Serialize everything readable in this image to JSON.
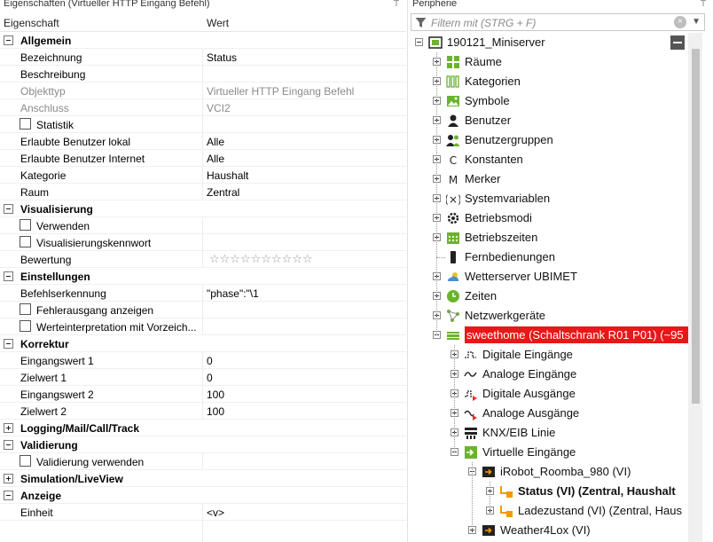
{
  "props": {
    "title": "Eigenschaften (Virtueller HTTP Eingang Befehl)",
    "col_name": "Eigenschaft",
    "col_value": "Wert",
    "rows": [
      {
        "kind": "cat",
        "label": "Allgemein",
        "expanded": true
      },
      {
        "kind": "prop",
        "label": "Bezeichnung",
        "value": "Status"
      },
      {
        "kind": "prop",
        "label": "Beschreibung",
        "value": ""
      },
      {
        "kind": "prop",
        "label": "Objekttyp",
        "value": "Virtueller HTTP Eingang Befehl",
        "disabled": true
      },
      {
        "kind": "prop",
        "label": "Anschluss",
        "value": "VCI2",
        "disabled": true
      },
      {
        "kind": "check",
        "label": "Statistik",
        "checked": false
      },
      {
        "kind": "prop",
        "label": "Erlaubte Benutzer lokal",
        "value": "Alle"
      },
      {
        "kind": "prop",
        "label": "Erlaubte Benutzer Internet",
        "value": "Alle"
      },
      {
        "kind": "prop",
        "label": "Kategorie",
        "value": "Haushalt"
      },
      {
        "kind": "prop",
        "label": "Raum",
        "value": "Zentral"
      },
      {
        "kind": "cat",
        "label": "Visualisierung",
        "expanded": true
      },
      {
        "kind": "check",
        "label": "Verwenden",
        "checked": false
      },
      {
        "kind": "check",
        "label": "Visualisierungskennwort",
        "checked": false
      },
      {
        "kind": "stars",
        "label": "Bewertung",
        "value": "☆☆☆☆☆☆☆☆☆☆"
      },
      {
        "kind": "cat",
        "label": "Einstellungen",
        "expanded": true
      },
      {
        "kind": "prop",
        "label": "Befehlserkennung",
        "value": "\"phase\":\"\\1"
      },
      {
        "kind": "check",
        "label": "Fehlerausgang anzeigen",
        "checked": false
      },
      {
        "kind": "check",
        "label": "Werteinterpretation mit Vorzeich...",
        "checked": false
      },
      {
        "kind": "cat",
        "label": "Korrektur",
        "expanded": true
      },
      {
        "kind": "prop",
        "label": "Eingangswert 1",
        "value": "0"
      },
      {
        "kind": "prop",
        "label": "Zielwert 1",
        "value": "0"
      },
      {
        "kind": "prop",
        "label": "Eingangswert 2",
        "value": "100"
      },
      {
        "kind": "prop",
        "label": "Zielwert 2",
        "value": "100"
      },
      {
        "kind": "cat",
        "label": "Logging/Mail/Call/Track",
        "expanded": false
      },
      {
        "kind": "cat",
        "label": "Validierung",
        "expanded": true
      },
      {
        "kind": "check",
        "label": "Validierung verwenden",
        "checked": false
      },
      {
        "kind": "cat",
        "label": "Simulation/LiveView",
        "expanded": false
      },
      {
        "kind": "cat",
        "label": "Anzeige",
        "expanded": true
      },
      {
        "kind": "prop",
        "label": "Einheit",
        "value": "<v>"
      }
    ]
  },
  "peri": {
    "title": "Peripherie",
    "filter_placeholder": "Filtern mit (STRG + F)",
    "clear_icon": "×",
    "dropdown_icon": "▼",
    "pin_icon": "📌",
    "tree": [
      {
        "level": 0,
        "label": "190121_Miniserver",
        "icon": "miniserver-icon",
        "exp": "minus"
      },
      {
        "level": 1,
        "label": "Räume",
        "icon": "rooms-icon",
        "exp": "plus"
      },
      {
        "level": 1,
        "label": "Kategorien",
        "icon": "categories-icon",
        "exp": "plus"
      },
      {
        "level": 1,
        "label": "Symbole",
        "icon": "symbols-icon",
        "exp": "plus"
      },
      {
        "level": 1,
        "label": "Benutzer",
        "icon": "user-icon",
        "exp": "plus"
      },
      {
        "level": 1,
        "label": "Benutzergruppen",
        "icon": "usergroups-icon",
        "exp": "plus"
      },
      {
        "level": 1,
        "label": "Konstanten",
        "icon": "constants-icon",
        "exp": "plus",
        "glyph": "C"
      },
      {
        "level": 1,
        "label": "Merker",
        "icon": "flags-icon",
        "exp": "plus",
        "glyph": "M"
      },
      {
        "level": 1,
        "label": "Systemvariablen",
        "icon": "system-variables-icon",
        "exp": "plus",
        "glyph": "(×)"
      },
      {
        "level": 1,
        "label": "Betriebsmodi",
        "icon": "operating-modes-icon",
        "exp": "plus"
      },
      {
        "level": 1,
        "label": "Betriebszeiten",
        "icon": "operating-times-icon",
        "exp": "plus"
      },
      {
        "level": 1,
        "label": "Fernbedienungen",
        "icon": "remote-icon",
        "exp": "none"
      },
      {
        "level": 1,
        "label": "Wetterserver UBIMET",
        "icon": "weather-icon",
        "exp": "plus"
      },
      {
        "level": 1,
        "label": "Zeiten",
        "icon": "clock-icon",
        "exp": "plus"
      },
      {
        "level": 1,
        "label": "Netzwerkgeräte",
        "icon": "network-icon",
        "exp": "plus"
      },
      {
        "level": 1,
        "label": "sweethome (Schaltschrank R01 P01) (~95",
        "icon": "extension-icon",
        "exp": "minus",
        "selected": true
      },
      {
        "level": 2,
        "label": "Digitale Eingänge",
        "icon": "digital-input-icon",
        "exp": "plus"
      },
      {
        "level": 2,
        "label": "Analoge Eingänge",
        "icon": "analog-input-icon",
        "exp": "plus"
      },
      {
        "level": 2,
        "label": "Digitale Ausgänge",
        "icon": "digital-output-icon",
        "exp": "plus"
      },
      {
        "level": 2,
        "label": "Analoge Ausgänge",
        "icon": "analog-output-icon",
        "exp": "plus"
      },
      {
        "level": 2,
        "label": "KNX/EIB Linie",
        "icon": "knx-icon",
        "exp": "plus"
      },
      {
        "level": 2,
        "label": "Virtuelle Eingänge",
        "icon": "virtual-input-icon",
        "exp": "minus"
      },
      {
        "level": 3,
        "label": "iRobot_Roomba_980 (VI)",
        "icon": "virtual-http-input-icon",
        "exp": "minus"
      },
      {
        "level": 4,
        "label": "Status (VI) (Zentral, Haushalt",
        "icon": "http-command-icon",
        "exp": "plus",
        "bold": true
      },
      {
        "level": 4,
        "label": "Ladezustand (VI) (Zentral, Haus",
        "icon": "http-command-icon",
        "exp": "plus"
      },
      {
        "level": 3,
        "label": "Weather4Lox (VI)",
        "icon": "virtual-http-input-icon",
        "exp": "plus"
      }
    ]
  },
  "colors": {
    "selection": "#e81818",
    "green": "#6ab42d",
    "dark": "#222222"
  }
}
